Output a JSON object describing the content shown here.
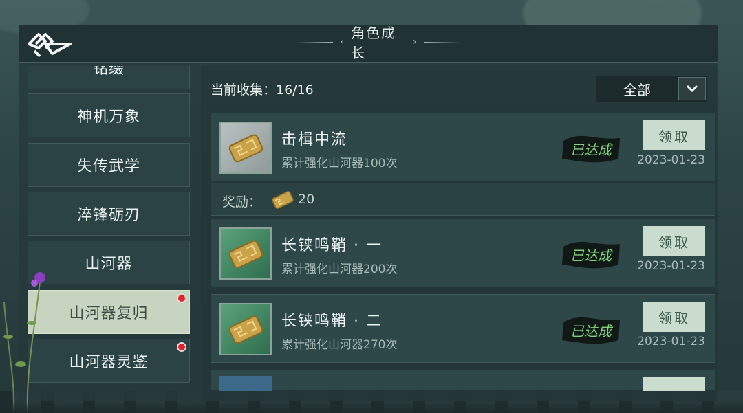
{
  "header": {
    "title": "角色成长"
  },
  "sidebar": {
    "items": [
      {
        "label": "铭缀"
      },
      {
        "label": "神机万象"
      },
      {
        "label": "失传武学"
      },
      {
        "label": "淬锋砺刃"
      },
      {
        "label": "山河器"
      },
      {
        "label": "山河器复归",
        "active": true,
        "badge": true
      },
      {
        "label": "山河器灵鉴",
        "badge": true
      }
    ]
  },
  "collection": {
    "label": "当前收集：",
    "value": "16/16"
  },
  "filter": {
    "selected": "全部"
  },
  "achievements": [
    {
      "title": "击楫中流",
      "desc": "累计强化山河器100次",
      "status": "已达成",
      "button": "领取",
      "date": "2023-01-23",
      "icon_style": "grey"
    },
    {
      "title": "长铗鸣鞘 · 一",
      "desc": "累计强化山河器200次",
      "status": "已达成",
      "button": "领取",
      "date": "2023-01-23",
      "icon_style": "green"
    },
    {
      "title": "长铗鸣鞘 · 二",
      "desc": "累计强化山河器270次",
      "status": "已达成",
      "button": "领取",
      "date": "2023-01-23",
      "icon_style": "green"
    }
  ],
  "reward": {
    "label": "奖励：",
    "amount": "20",
    "icon": "token-icon"
  },
  "colors": {
    "accent": "#c9dccd",
    "badge": "#e0242b",
    "active_tab": "#c7d5c0"
  }
}
